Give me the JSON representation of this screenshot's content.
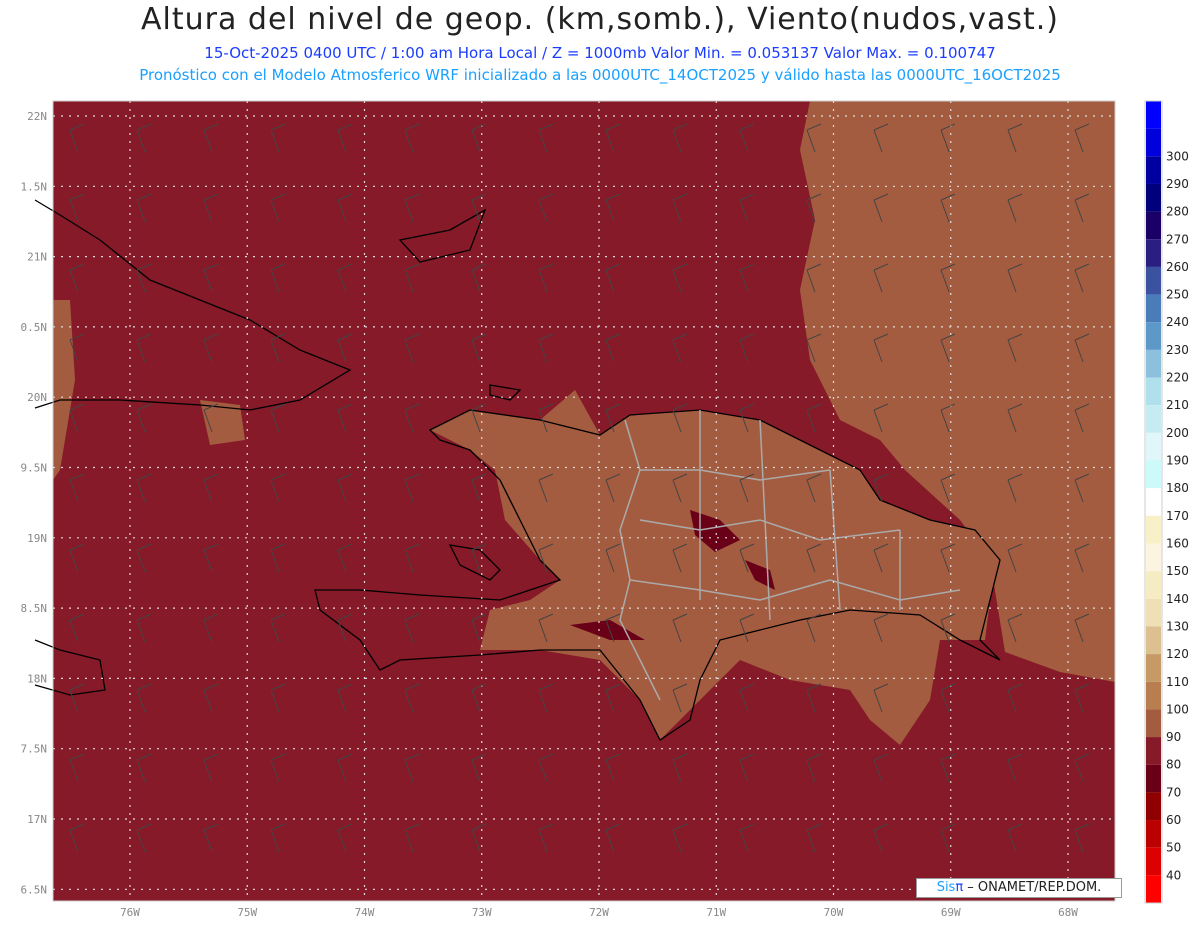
{
  "title": "Altura del nivel de geop. (km,somb.), Viento(nudos,vast.)",
  "subtitle": "15-Oct-2025  0400 UTC / 1:00 am Hora Local / Z = 1000mb  Valor Min. = 0.053137  Valor Max. = 0.100747",
  "subtitle2": "Pronóstico con el Modelo Atmosferico WRF inicializado a las 0000UTC_14OCT2025 y válido hasta las  0000UTC_16OCT2025",
  "credit": {
    "brand": "Sis",
    "pi": "π",
    "text": " – ONAMET/REP.DOM."
  },
  "lon_labels": [
    "76W",
    "75W",
    "74W",
    "73W",
    "72W",
    "71W",
    "70W",
    "69W",
    "68W"
  ],
  "lat_labels": [
    "22N",
    "1.5N",
    "21N",
    "0.5N",
    "20N",
    "9.5N",
    "19N",
    "8.5N",
    "18N",
    "7.5N",
    "17N",
    "6.5N"
  ],
  "colorbar": {
    "labels": [
      "300",
      "290",
      "280",
      "270",
      "260",
      "250",
      "240",
      "230",
      "220",
      "210",
      "200",
      "190",
      "180",
      "170",
      "160",
      "150",
      "140",
      "130",
      "120",
      "110",
      "100",
      "90",
      "80",
      "70",
      "60",
      "50",
      "40"
    ],
    "colors": [
      "#0000ff",
      "#0000dd",
      "#0000a0",
      "#00007a",
      "#1a0066",
      "#2a1e80",
      "#3a52a0",
      "#4a7cba",
      "#5c98c8",
      "#8cc0dc",
      "#b0e0ec",
      "#c4ecf2",
      "#e0f6f8",
      "#ccfafa",
      "#ffffff",
      "#f8f0c8",
      "#faf4e0",
      "#f6ecc4",
      "#eedfb4",
      "#dcc090",
      "#c69a64",
      "#b87e50",
      "#a45c40",
      "#861a28",
      "#6a0018",
      "#900000",
      "#bb0000",
      "#dd0000",
      "#ff0000"
    ]
  },
  "colors": {
    "sea": "#861a28",
    "land": "#a45c40",
    "dark": "#6a0018"
  }
}
